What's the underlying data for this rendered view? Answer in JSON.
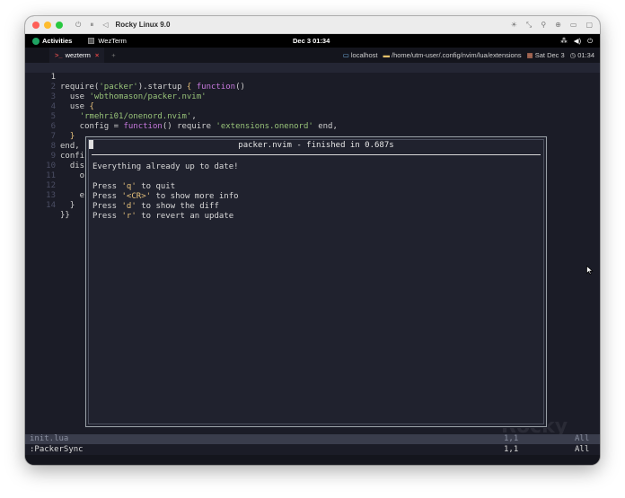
{
  "window": {
    "title": "Rocky Linux 9.0"
  },
  "gnome": {
    "activities_label": "Activities",
    "app_label": "WezTerm",
    "clock": "Dec 3  01:34"
  },
  "tabs": {
    "index_label": " ",
    "active_tab_label": "wezterm",
    "new_tab_label": "+"
  },
  "status": {
    "host": "localhost",
    "path": "/home/utm-user/.config/nvim/lua/extensions",
    "date": "Sat Dec 3",
    "time": "01:34"
  },
  "editor": {
    "lines": [
      {
        "n": "1"
      },
      {
        "n": "2"
      },
      {
        "n": "3"
      },
      {
        "n": "4"
      },
      {
        "n": "5"
      },
      {
        "n": "6"
      },
      {
        "n": "7"
      },
      {
        "n": "8"
      },
      {
        "n": "9"
      },
      {
        "n": "10"
      },
      {
        "n": "11"
      },
      {
        "n": "12"
      },
      {
        "n": "13"
      },
      {
        "n": "14"
      }
    ],
    "code": {
      "l1_a": "require(",
      "l1_b": "'packer'",
      "l1_c": ").startup ",
      "l1_d": "{",
      "l1_e": " ",
      "l1_f": "function",
      "l1_g": "()",
      "l2_a": "  use ",
      "l2_b": "'wbthomason/packer.nvim'",
      "l3_a": "  use ",
      "l3_b": "{",
      "l4_a": "    ",
      "l4_b": "'rmehri01/onenord.nvim'",
      "l4_c": ",",
      "l5_a": "    config = ",
      "l5_b": "function",
      "l5_c": "() require ",
      "l5_d": "'extensions.onenord'",
      "l5_e": " end,",
      "l6_a": "  ",
      "l6_b": "}",
      "l7": "end,",
      "l8": "confi",
      "l9": "  dis",
      "l10": "    o",
      "l11": "",
      "l12": "    e",
      "l13": "  }",
      "l14": "}}"
    },
    "watermark": "Rocky"
  },
  "packer": {
    "title": "packer.nvim - finished in 0.687s",
    "message": "Everything already up to date!",
    "hints": [
      {
        "pre": "Press ",
        "key": "'q'",
        "post": " to quit"
      },
      {
        "pre": "Press ",
        "key": "'<CR>'",
        "post": " to show more info"
      },
      {
        "pre": "Press ",
        "key": "'d'",
        "post": " to show the diff"
      },
      {
        "pre": "Press ",
        "key": "'r'",
        "post": " to revert an update"
      }
    ]
  },
  "statusline": {
    "file": "init.lua",
    "pos": "1,1",
    "scroll": "All"
  },
  "cmdline": {
    "text": ":PackerSync",
    "pos": "1,1",
    "scroll": "All"
  }
}
